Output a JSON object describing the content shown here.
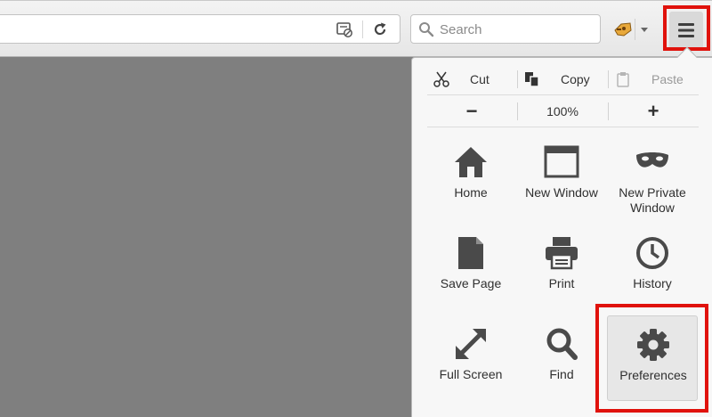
{
  "toolbar": {
    "search_placeholder": "Search",
    "reader_icon": "reader-view-icon",
    "reload_icon": "reload-icon",
    "search_icon": "search-icon",
    "addon_icon": "addon-icon",
    "menu_icon": "hamburger-menu-icon"
  },
  "menu": {
    "edit": {
      "cut": "Cut",
      "copy": "Copy",
      "paste": "Paste"
    },
    "zoom": {
      "out": "−",
      "level": "100%",
      "in": "+"
    },
    "items": [
      {
        "label": "Home",
        "icon": "home-icon"
      },
      {
        "label": "New Window",
        "icon": "new-window-icon"
      },
      {
        "label": "New Private\nWindow",
        "icon": "private-mask-icon"
      },
      {
        "label": "Save Page",
        "icon": "save-page-icon"
      },
      {
        "label": "Print",
        "icon": "printer-icon"
      },
      {
        "label": "History",
        "icon": "clock-icon"
      },
      {
        "label": "Full Screen",
        "icon": "fullscreen-arrows-icon"
      },
      {
        "label": "Find",
        "icon": "magnifier-icon"
      },
      {
        "label": "Preferences",
        "icon": "gear-icon"
      }
    ]
  },
  "colors": {
    "highlight": "#e0120c",
    "content_background": "#7f7f7f",
    "icon": "#4a4a4a"
  }
}
